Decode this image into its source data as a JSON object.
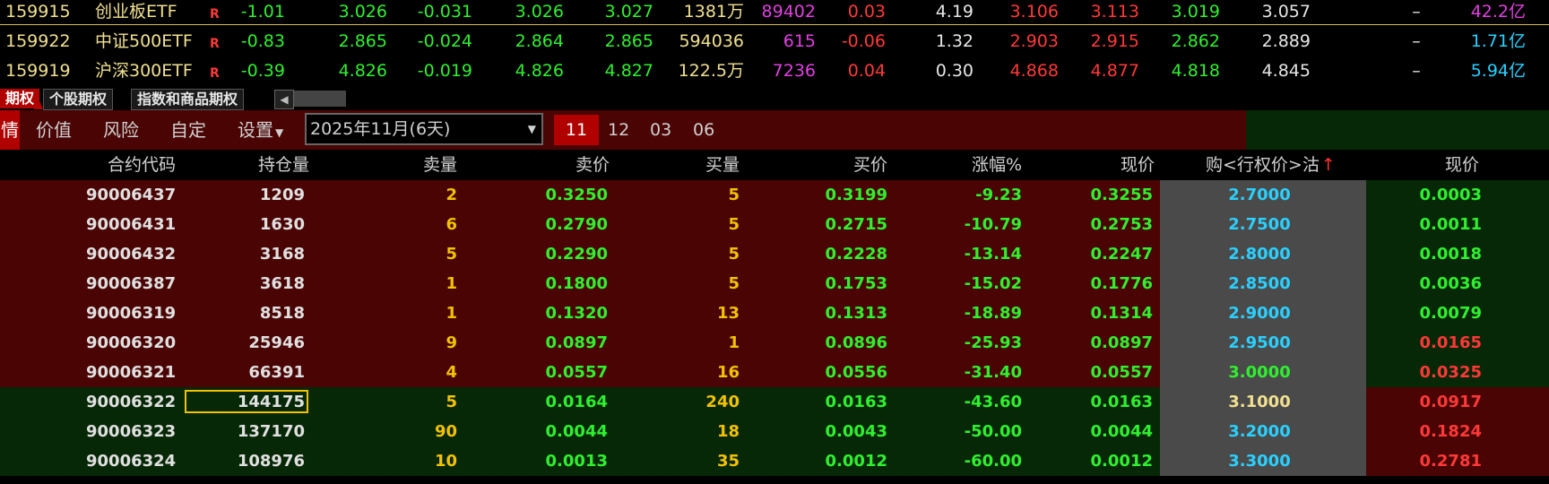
{
  "quotes": [
    {
      "code": "159915",
      "name": "创业板ETF",
      "flag": "R",
      "change": "-1.01",
      "price": "3.026",
      "chg2": "-0.031",
      "buy": "3.026",
      "sell": "3.027",
      "vol": "1381万",
      "cur": "89402",
      "pct": "0.03",
      "turn": "4.19",
      "open": "3.106",
      "high": "3.113",
      "low": "3.019",
      "prev": "3.057",
      "dash": "–",
      "amt": "42.2亿",
      "amtColor": "#e040e0"
    },
    {
      "code": "159922",
      "name": "中证500ETF",
      "flag": "R",
      "change": "-0.83",
      "price": "2.865",
      "chg2": "-0.024",
      "buy": "2.864",
      "sell": "2.865",
      "vol": "594036",
      "cur": "615",
      "pct": "-0.06",
      "turn": "1.32",
      "open": "2.903",
      "high": "2.915",
      "low": "2.862",
      "prev": "2.889",
      "dash": "–",
      "amt": "1.71亿",
      "amtColor": "#2ad0ff"
    },
    {
      "code": "159919",
      "name": "沪深300ETF",
      "flag": "R",
      "change": "-0.39",
      "price": "4.826",
      "chg2": "-0.019",
      "buy": "4.826",
      "sell": "4.827",
      "vol": "122.5万",
      "cur": "7236",
      "pct": "0.04",
      "turn": "0.30",
      "open": "4.868",
      "high": "4.877",
      "low": "4.818",
      "prev": "4.845",
      "dash": "–",
      "amt": "5.94亿",
      "amtColor": "#2ad0ff"
    }
  ],
  "tabs": [
    "期权",
    "个股期权",
    "指数和商品期权"
  ],
  "toolbar": {
    "first": "情",
    "items": [
      "价值",
      "风险",
      "自定",
      "设置"
    ],
    "month_select": "2025年11月(6天)",
    "months": [
      "11",
      "12",
      "03",
      "06"
    ],
    "active_month": "11"
  },
  "header": {
    "code": "合约代码",
    "oi": "持仓量",
    "ask_vol": "卖量",
    "ask": "卖价",
    "bid_vol": "买量",
    "bid": "买价",
    "chg_pct": "涨幅%",
    "last": "现价",
    "strike": "购<行权价>沽",
    "put_last": "现价"
  },
  "rows": [
    {
      "code": "90006437",
      "oi": "1209",
      "askv": "2",
      "ask": "0.3250",
      "bidv": "5",
      "bid": "0.3199",
      "pct": "-9.23",
      "last": "0.3255",
      "strike": "2.7000",
      "put": "0.0003",
      "zone": "itm",
      "putColor": "#2ff02f",
      "strikeColor": "#2ad0ff"
    },
    {
      "code": "90006431",
      "oi": "1630",
      "askv": "6",
      "ask": "0.2790",
      "bidv": "5",
      "bid": "0.2715",
      "pct": "-10.79",
      "last": "0.2753",
      "strike": "2.7500",
      "put": "0.0011",
      "zone": "itm",
      "putColor": "#2ff02f",
      "strikeColor": "#2ad0ff"
    },
    {
      "code": "90006432",
      "oi": "3168",
      "askv": "5",
      "ask": "0.2290",
      "bidv": "5",
      "bid": "0.2228",
      "pct": "-13.14",
      "last": "0.2247",
      "strike": "2.8000",
      "put": "0.0018",
      "zone": "itm",
      "putColor": "#2ff02f",
      "strikeColor": "#2ad0ff"
    },
    {
      "code": "90006387",
      "oi": "3618",
      "askv": "1",
      "ask": "0.1800",
      "bidv": "5",
      "bid": "0.1753",
      "pct": "-15.02",
      "last": "0.1776",
      "strike": "2.8500",
      "put": "0.0036",
      "zone": "itm",
      "putColor": "#2ff02f",
      "strikeColor": "#2ad0ff"
    },
    {
      "code": "90006319",
      "oi": "8518",
      "askv": "1",
      "ask": "0.1320",
      "bidv": "13",
      "bid": "0.1313",
      "pct": "-18.89",
      "last": "0.1314",
      "strike": "2.9000",
      "put": "0.0079",
      "zone": "itm",
      "putColor": "#2ff02f",
      "strikeColor": "#2ad0ff"
    },
    {
      "code": "90006320",
      "oi": "25946",
      "askv": "9",
      "ask": "0.0897",
      "bidv": "1",
      "bid": "0.0896",
      "pct": "-25.93",
      "last": "0.0897",
      "strike": "2.9500",
      "put": "0.0165",
      "zone": "itm",
      "putColor": "#ff3838",
      "strikeColor": "#2ad0ff"
    },
    {
      "code": "90006321",
      "oi": "66391",
      "askv": "4",
      "ask": "0.0557",
      "bidv": "16",
      "bid": "0.0556",
      "pct": "-31.40",
      "last": "0.0557",
      "strike": "3.0000",
      "put": "0.0325",
      "zone": "itm",
      "putColor": "#ff3838",
      "strikeColor": "#2ff02f"
    },
    {
      "code": "90006322",
      "oi": "144175",
      "askv": "5",
      "ask": "0.0164",
      "bidv": "240",
      "bid": "0.0163",
      "pct": "-43.60",
      "last": "0.0163",
      "strike": "3.1000",
      "put": "0.0917",
      "zone": "otm",
      "putColor": "#ff3838",
      "strikeColor": "#f0e090",
      "selected": true
    },
    {
      "code": "90006323",
      "oi": "137170",
      "askv": "90",
      "ask": "0.0044",
      "bidv": "18",
      "bid": "0.0043",
      "pct": "-50.00",
      "last": "0.0044",
      "strike": "3.2000",
      "put": "0.1824",
      "zone": "otm",
      "putColor": "#ff3838",
      "strikeColor": "#2ad0ff"
    },
    {
      "code": "90006324",
      "oi": "108976",
      "askv": "10",
      "ask": "0.0013",
      "bidv": "35",
      "bid": "0.0012",
      "pct": "-60.00",
      "last": "0.0012",
      "strike": "3.3000",
      "put": "0.2781",
      "zone": "otm",
      "putColor": "#ff3838",
      "strikeColor": "#2ad0ff"
    }
  ],
  "colors": {
    "itm_bg": "#4a0404",
    "otm_bg": "#062806",
    "strike_bg": "#4a4a4a",
    "put_itm_bg": "#062806",
    "put_otm_bg": "#4a0404",
    "active_month_bg": "#b00000"
  }
}
